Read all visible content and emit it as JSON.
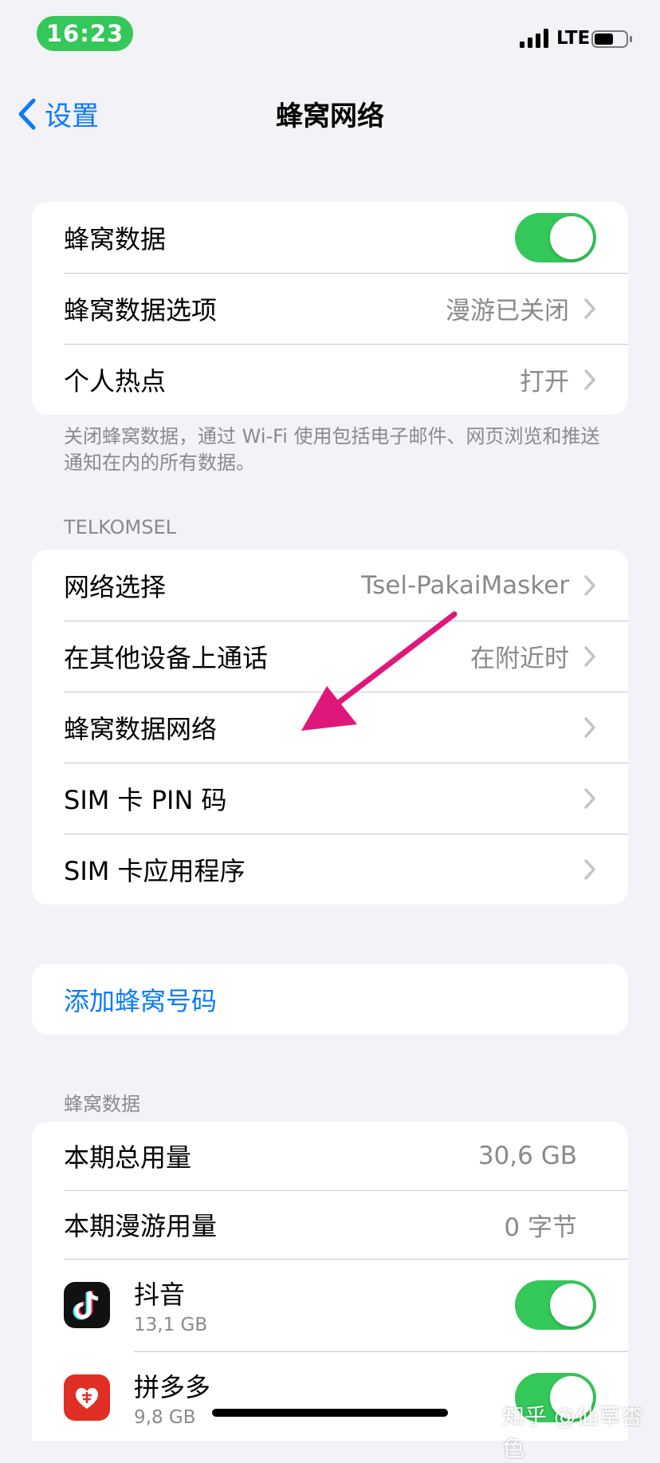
{
  "status_bar": {
    "time": "16:23",
    "network": "LTE",
    "icons": [
      "signal-icon",
      "battery-icon"
    ]
  },
  "nav": {
    "back_label": "设置",
    "title": "蜂窝网络"
  },
  "group1": {
    "cellular_data": "蜂窝数据",
    "cellular_data_on": true,
    "options_label": "蜂窝数据选项",
    "options_value": "漫游已关闭",
    "hotspot_label": "个人热点",
    "hotspot_value": "打开"
  },
  "footer_note": "关闭蜂窝数据，通过 Wi-Fi 使用包括电子邮件、网页浏览和推送通知在内的所有数据。",
  "carrier_header": "TELKOMSEL",
  "group2": {
    "network_label": "网络选择",
    "network_value": "Tsel-PakaiMasker",
    "calls_label": "在其他设备上通话",
    "calls_value": "在附近时",
    "data_network_label": "蜂窝数据网络",
    "pin_label": "SIM 卡 PIN 码",
    "apps_label": "SIM 卡应用程序"
  },
  "add_plan_label": "添加蜂窝号码",
  "data_header": "蜂窝数据",
  "usage": {
    "total_label": "本期总用量",
    "total_value": "30,6 GB",
    "roaming_label": "本期漫游用量",
    "roaming_value": "0 字节"
  },
  "apps": [
    {
      "name": "抖音",
      "size": "13,1 GB",
      "enabled": true
    },
    {
      "name": "拼多多",
      "size": "9,8 GB",
      "enabled": true
    }
  ],
  "watermark": "知乎 @仙草杏色",
  "colors": {
    "accent": "#0a7aff",
    "toggle_on": "#34c759",
    "arrow": "#e0177a"
  }
}
